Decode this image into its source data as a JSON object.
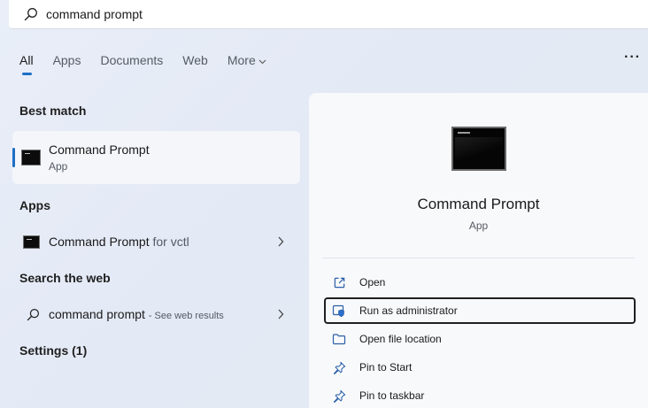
{
  "search": {
    "value": "command prompt"
  },
  "tabs": [
    {
      "label": "All"
    },
    {
      "label": "Apps"
    },
    {
      "label": "Documents"
    },
    {
      "label": "Web"
    },
    {
      "label": "More"
    }
  ],
  "more_options": "···",
  "sections": {
    "best_match": "Best match",
    "apps": "Apps",
    "search_web": "Search the web",
    "settings": "Settings (1)"
  },
  "best_match": {
    "name": "Command Prompt",
    "type": "App"
  },
  "apps": [
    {
      "name": "Command Prompt",
      "suffix": "for vctl"
    }
  ],
  "web": {
    "query": "command prompt",
    "hint": "- See web results"
  },
  "details": {
    "title": "Command Prompt",
    "type": "App",
    "actions": [
      {
        "label": "Open",
        "icon": "open-icon"
      },
      {
        "label": "Run as administrator",
        "icon": "shield-icon"
      },
      {
        "label": "Open file location",
        "icon": "folder-icon"
      },
      {
        "label": "Pin to Start",
        "icon": "pin-icon"
      },
      {
        "label": "Pin to taskbar",
        "icon": "pin-icon"
      }
    ]
  },
  "colors": {
    "accent": "#1f6fc7",
    "panel": "#f8f9fb"
  }
}
